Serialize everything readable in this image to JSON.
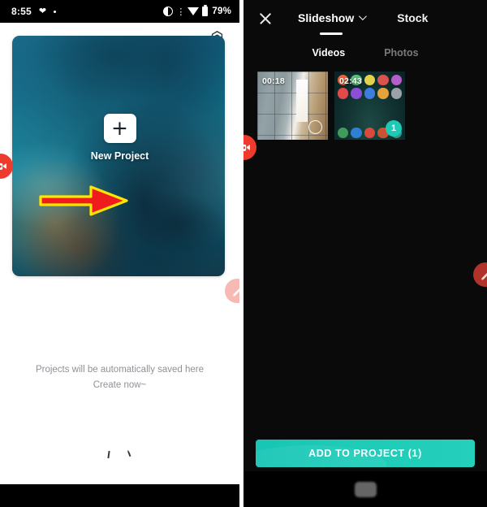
{
  "left_panel": {
    "status_bar": {
      "time": "8:55",
      "heart_icon": "heart-icon",
      "dot_icon": "dot-icon",
      "contrast_icon": "contrast-icon",
      "vibrate_icon": "vibrate-icon",
      "wifi_icon": "wifi-icon",
      "battery_icon": "battery-icon",
      "battery_percent": "79%"
    },
    "settings_icon": "gear-icon",
    "hero_card": {
      "name": "project-hero-image",
      "description": "teal smoke bomb photo"
    },
    "new_project": {
      "plus_icon": "plus-icon",
      "label": "New Project"
    },
    "empty_state": {
      "line1": "Projects will be automatically saved here",
      "line2": "Create now~"
    },
    "floating_badges": {
      "video_badge_icon": "video-camera-icon",
      "edit_badge_icon": "pencil-icon"
    },
    "annotation": {
      "arrow_icon": "right-arrow-annotation",
      "arrow_fill": "#ee1c1c",
      "arrow_stroke": "#ffe600"
    }
  },
  "right_panel": {
    "header": {
      "close_icon": "close-icon",
      "tabs": [
        {
          "label": "Slideshow",
          "active": true,
          "chevron_icon": "chevron-down-icon"
        },
        {
          "label": "Stock",
          "active": false
        }
      ]
    },
    "sub_tabs": [
      {
        "label": "Videos",
        "active": true
      },
      {
        "label": "Photos",
        "active": false
      }
    ],
    "media_items": [
      {
        "duration": "00:18",
        "selected": false,
        "selection_icon": "empty-circle-icon"
      },
      {
        "duration": "02:43",
        "selected": true,
        "selection_badge": "1"
      }
    ],
    "floating_badges": {
      "video_badge_icon": "video-camera-icon",
      "edit_badge_icon": "pencil-icon"
    },
    "annotation": {
      "arrow_icon": "down-arrow-annotation",
      "arrow_fill": "#ee1c1c",
      "arrow_stroke": "#ffe600"
    },
    "add_button": {
      "label": "ADD TO PROJECT (1)",
      "color": "#1ecbb8"
    },
    "nav_bar": {
      "home_icon": "home-pill-icon"
    }
  },
  "colors": {
    "accent_teal": "#1ecbb8",
    "badge_red": "#ef3b2d",
    "annotation_red": "#ee1c1c",
    "annotation_yellow": "#ffe600"
  }
}
